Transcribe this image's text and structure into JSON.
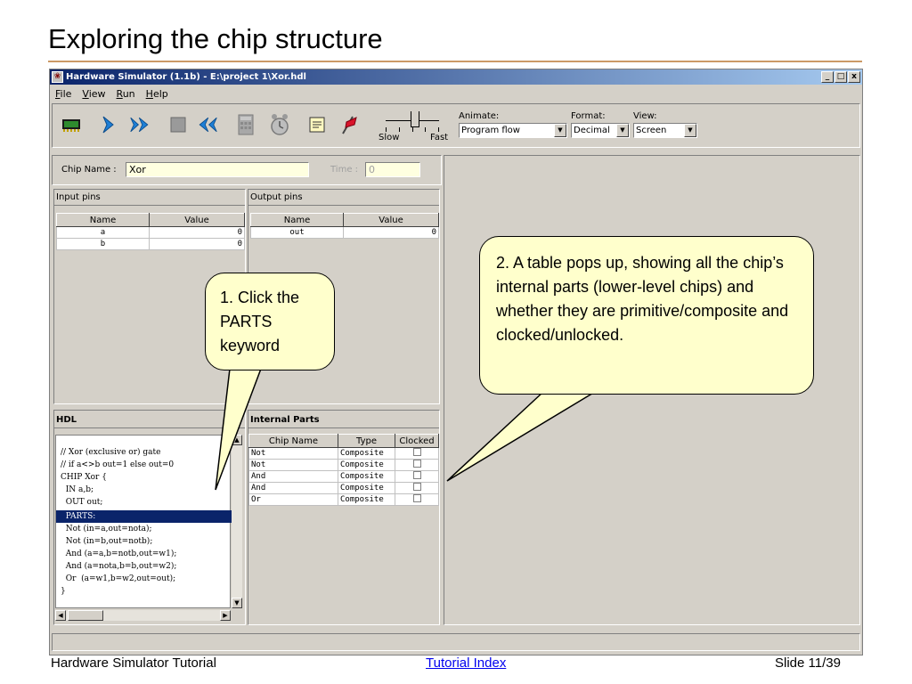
{
  "slide": {
    "title": "Exploring the chip structure",
    "footer_left": "Hardware Simulator Tutorial",
    "footer_link": "Tutorial Index",
    "footer_right": "Slide 11/39"
  },
  "window": {
    "title": "Hardware Simulator (1.1b) - E:\\project 1\\Xor.hdl",
    "min": "_",
    "max": "□",
    "close": "x"
  },
  "menu": {
    "items": [
      {
        "key": "F",
        "rest": "ile"
      },
      {
        "key": "V",
        "rest": "iew"
      },
      {
        "key": "R",
        "rest": "un"
      },
      {
        "key": "H",
        "rest": "elp"
      }
    ]
  },
  "toolbar": {
    "icons": [
      "chip-icon",
      "single-step-icon",
      "fast-forward-icon",
      "stop-icon",
      "rewind-icon",
      "calculator-icon",
      "clock-icon",
      "script-icon",
      "breakpoint-flag-icon"
    ],
    "slow_label": "Slow",
    "fast_label": "Fast",
    "animate_label": "Animate:",
    "animate_value": "Program flow",
    "format_label": "Format:",
    "format_value": "Decimal",
    "view_label": "View:",
    "view_value": "Screen"
  },
  "chip": {
    "name_label": "Chip Name :",
    "name_value": "Xor",
    "time_label": "Time :",
    "time_value": "0"
  },
  "input_pins": {
    "title": "Input pins",
    "headers": [
      "Name",
      "Value"
    ],
    "rows": [
      [
        "a",
        "0"
      ],
      [
        "b",
        "0"
      ]
    ]
  },
  "output_pins": {
    "title": "Output pins",
    "headers": [
      "Name",
      "Value"
    ],
    "rows": [
      [
        "out",
        "0"
      ]
    ]
  },
  "hdl": {
    "title": "HDL",
    "lines": [
      "// Xor (exclusive or) gate",
      "// if a<>b out=1 else out=0",
      "CHIP Xor {",
      "  IN a,b;",
      "  OUT out;",
      "  PARTS:",
      "  Not (in=a,out=nota);",
      "  Not (in=b,out=notb);",
      "  And (a=a,b=notb,out=w1);",
      "  And (a=nota,b=b,out=w2);",
      "  Or  (a=w1,b=w2,out=out);",
      "}"
    ]
  },
  "internal_parts": {
    "title": "Internal Parts",
    "headers": [
      "Chip Name",
      "Type",
      "Clocked"
    ],
    "rows": [
      [
        "Not",
        "Composite"
      ],
      [
        "Not",
        "Composite"
      ],
      [
        "And",
        "Composite"
      ],
      [
        "And",
        "Composite"
      ],
      [
        "Or",
        "Composite"
      ]
    ]
  },
  "callouts": {
    "one": "1. Click the PARTS keyword",
    "two": "2. A table pops up, showing all the chip’s internal parts (lower-level chips) and whether they are primitive/composite and  clocked/unlocked."
  },
  "colors": {
    "selection": "#0a246a",
    "callout_fill": "#ffffcc",
    "title_rule": "#cc9966",
    "link": "#0000ee"
  }
}
